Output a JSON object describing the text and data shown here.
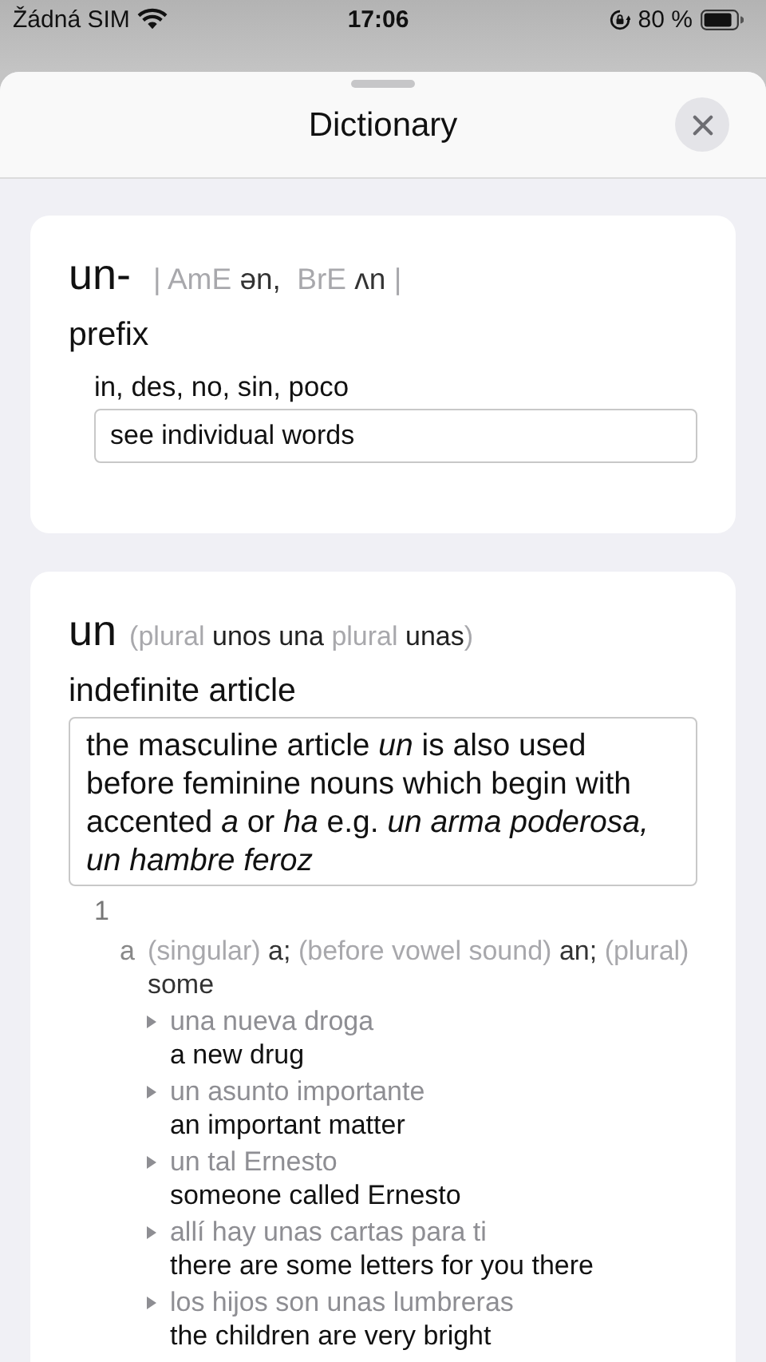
{
  "status_bar": {
    "carrier": "Žádná SIM",
    "time": "17:06",
    "battery": "80 %"
  },
  "sheet": {
    "title": "Dictionary"
  },
  "entries": [
    {
      "headword": "un-",
      "head_extra": [
        {
          "kind": "label",
          "text": "| AmE "
        },
        {
          "kind": "text",
          "text": "ən,"
        },
        {
          "kind": "label",
          "text": "  BrE "
        },
        {
          "kind": "text",
          "text": "ʌn"
        },
        {
          "kind": "label",
          "text": " |"
        }
      ],
      "part_of_speech": "prefix",
      "blocks": [
        {
          "kind": "translation",
          "text": "in, des, no, sin, poco"
        },
        {
          "kind": "note",
          "text": "see individual words"
        }
      ]
    },
    {
      "headword": "un",
      "head_extra": [
        {
          "kind": "label",
          "text": "(plural "
        },
        {
          "kind": "form",
          "text": "unos una"
        },
        {
          "kind": "label",
          "text": " plural "
        },
        {
          "kind": "form",
          "text": "unas"
        },
        {
          "kind": "label",
          "text": ")"
        }
      ],
      "part_of_speech": "indefinite article",
      "blocks": [
        {
          "kind": "wide_note",
          "text": "the masculine article *un* is also used before feminine nouns which begin with accented *a* or *ha* e.g. *un arma poderosa, un hambre feroz*"
        },
        {
          "kind": "sense",
          "number": "1",
          "subsenses": [
            {
              "letter": "a",
              "gloss": [
                {
                  "kind": "label",
                  "text": "(singular)"
                },
                {
                  "kind": "text",
                  "text": " a; "
                },
                {
                  "kind": "label",
                  "text": "(before vowel sound)"
                },
                {
                  "kind": "text",
                  "text": " an; "
                },
                {
                  "kind": "label",
                  "text": "(plural)"
                },
                {
                  "kind": "text",
                  "text": " some"
                }
              ],
              "examples": [
                {
                  "phrase": "una nueva droga",
                  "translation": "a new drug"
                },
                {
                  "phrase": "un asunto importante",
                  "translation": "an important matter"
                },
                {
                  "phrase": "un tal Ernesto",
                  "translation": "someone called Ernesto"
                },
                {
                  "phrase": "allí hay unas cartas para ti",
                  "translation": "there are some letters for you there"
                },
                {
                  "phrase": "los hijos son unas lumbreras",
                  "translation": "the children are very bright"
                }
              ]
            }
          ]
        }
      ]
    }
  ]
}
